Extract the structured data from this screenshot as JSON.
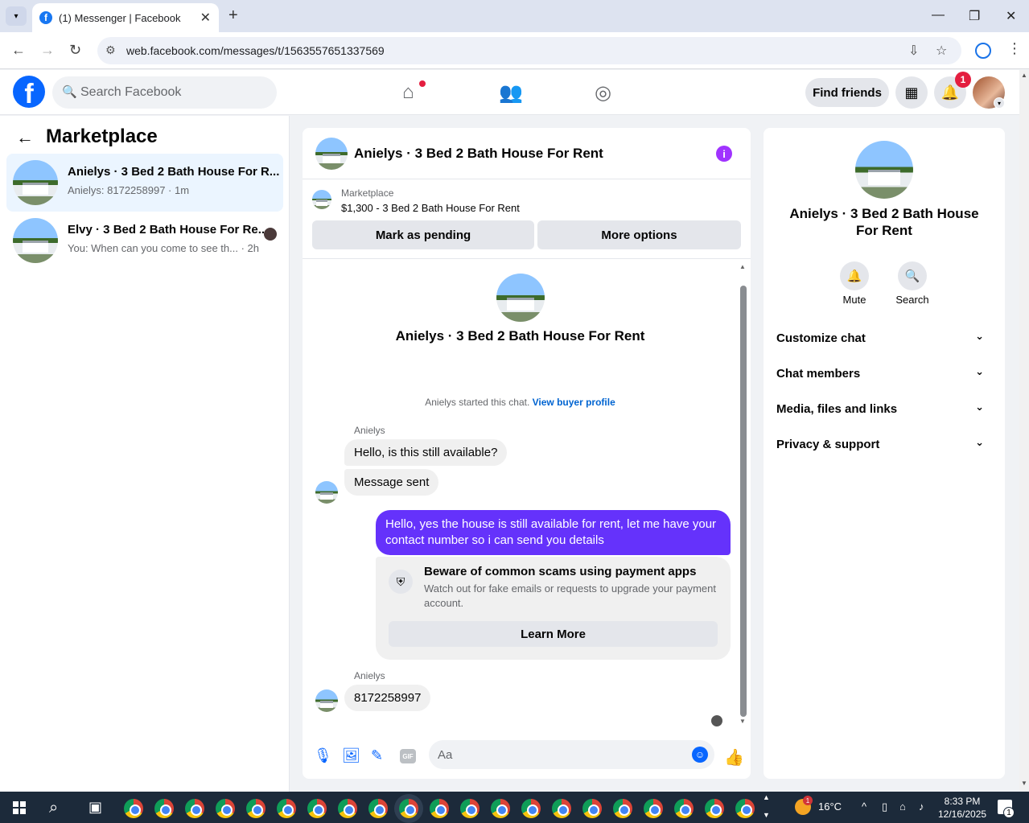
{
  "browser": {
    "tab_title": "(1) Messenger | Facebook",
    "url": "web.facebook.com/messages/t/1563557651337569"
  },
  "fb_header": {
    "search_placeholder": "Search Facebook",
    "find_friends": "Find friends",
    "notification_count": "1"
  },
  "left_pane": {
    "title": "Marketplace",
    "conversations": [
      {
        "name": "Anielys · 3 Bed 2 Bath House For R...",
        "preview": "Anielys: 8172258997 · 1m",
        "active": true
      },
      {
        "name": "Elvy · 3 Bed 2 Bath House For Re...",
        "preview": "You: When can you come to see th... · 2h",
        "active": false
      }
    ]
  },
  "chat": {
    "title": "Anielys · 3 Bed 2 Bath House For Rent",
    "marketplace_label": "Marketplace",
    "listing": "$1,300 - 3 Bed 2 Bath House For Rent",
    "mark_pending": "Mark as pending",
    "more_options": "More options",
    "intro_name": "Anielys · 3 Bed 2 Bath House For Rent",
    "started_text": "Anielys started this chat.",
    "view_buyer_profile": "View buyer profile",
    "messages": [
      {
        "sender": "Anielys",
        "text": "Hello, is this still available?"
      },
      {
        "text": "Message sent"
      },
      {
        "text": "Hello, yes the house is still available for rent, let me have your contact number so i can send you  details"
      },
      {
        "sender": "Anielys",
        "text": "8172258997"
      }
    ],
    "scam_title": "Beware of common scams using payment apps",
    "scam_text": "Watch out for fake emails or requests to upgrade your payment account.",
    "learn_more": "Learn More",
    "composer_placeholder": "Aa",
    "gif_label": "GIF"
  },
  "right_pane": {
    "title": "Anielys · 3 Bed 2 Bath House For Rent",
    "mute": "Mute",
    "search": "Search",
    "sections": [
      "Customize chat",
      "Chat members",
      "Media, files and links",
      "Privacy & support"
    ]
  },
  "taskbar": {
    "temperature": "16°C",
    "time": "8:33 PM",
    "date": "12/16/2025",
    "weather_badge": "1",
    "notif_badge": "1"
  },
  "colors": {
    "accent": "#0866ff",
    "outgoing_bubble": "#6532fb",
    "active_row": "#ebf5ff",
    "info_icon": "#a033ff"
  }
}
